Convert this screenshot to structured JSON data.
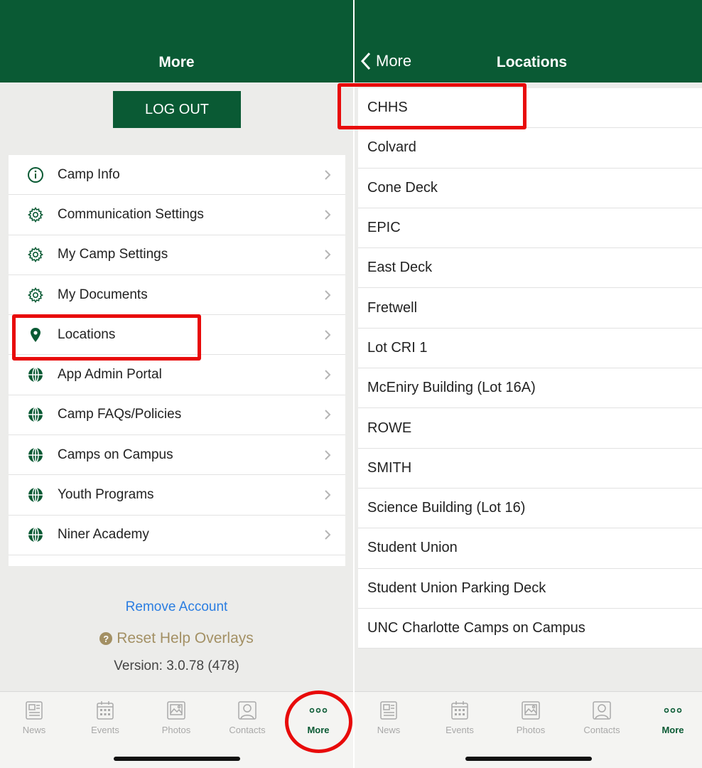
{
  "left": {
    "header_title": "More",
    "logout_label": "LOG OUT",
    "menu": [
      {
        "label": "Camp Info",
        "icon": "info-icon"
      },
      {
        "label": "Communication Settings",
        "icon": "gear-icon"
      },
      {
        "label": "My Camp Settings",
        "icon": "gear-icon"
      },
      {
        "label": "My Documents",
        "icon": "gear-icon"
      },
      {
        "label": "Locations",
        "icon": "location-pin-icon"
      },
      {
        "label": "App Admin Portal",
        "icon": "globe-icon"
      },
      {
        "label": "Camp FAQs/Policies",
        "icon": "globe-icon"
      },
      {
        "label": "Camps on Campus",
        "icon": "globe-icon"
      },
      {
        "label": "Youth Programs",
        "icon": "globe-icon"
      },
      {
        "label": "Niner Academy",
        "icon": "globe-icon"
      }
    ],
    "remove_account": "Remove Account",
    "reset_help": "Reset Help Overlays",
    "version": "Version: 3.0.78 (478)"
  },
  "right": {
    "back_label": "More",
    "header_title": "Locations",
    "locations": [
      "CHHS",
      "Colvard",
      "Cone Deck",
      "EPIC",
      "East Deck",
      "Fretwell",
      "Lot CRI 1",
      "McEniry Building (Lot 16A)",
      "ROWE",
      "SMITH",
      "Science Building (Lot 16)",
      "Student Union",
      "Student Union Parking Deck",
      "UNC Charlotte Camps on Campus"
    ]
  },
  "tabbar": {
    "tabs": [
      {
        "label": "News",
        "icon": "newspaper-icon"
      },
      {
        "label": "Events",
        "icon": "calendar-icon"
      },
      {
        "label": "Photos",
        "icon": "photo-icon"
      },
      {
        "label": "Contacts",
        "icon": "contact-icon"
      },
      {
        "label": "More",
        "icon": "more-dots-icon"
      }
    ],
    "active": "More"
  },
  "colors": {
    "brand_green": "#0a5a34",
    "link_blue": "#2a7de1",
    "gold": "#a39064",
    "highlight_red": "#e80a0a"
  }
}
